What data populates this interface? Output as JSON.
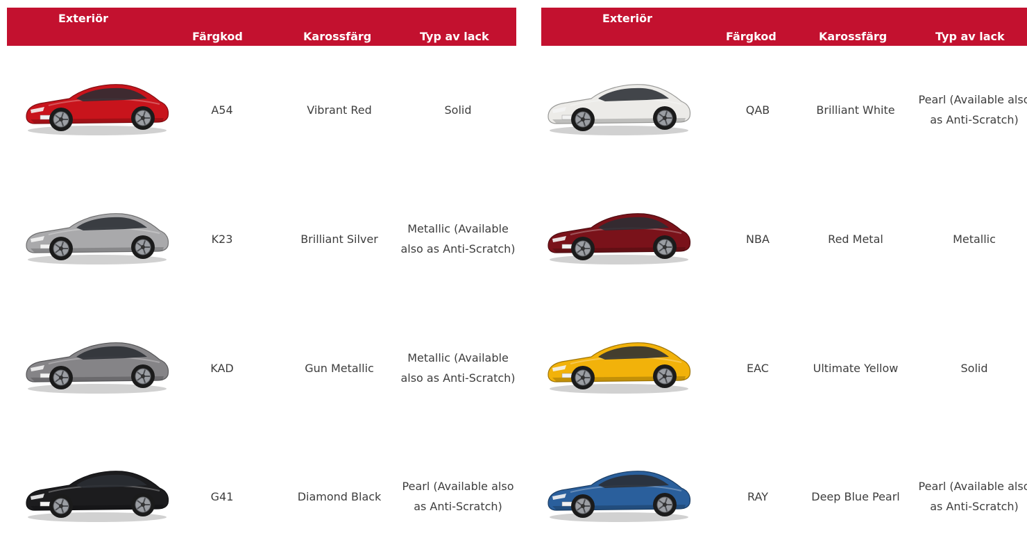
{
  "headers": {
    "exterior": "Exteriör",
    "color_code": "Färgkod",
    "body_color": "Karossfärg",
    "paint_type": "Typ av lack"
  },
  "colors": {
    "header_bg": "#c3112f",
    "header_text": "#ffffff",
    "text": "#3d3d3d"
  },
  "left_table": [
    {
      "code": "A54",
      "name": "Vibrant Red",
      "paint": "Solid",
      "car_color": "#c8141c",
      "car_icon": "car-red-icon"
    },
    {
      "code": "K23",
      "name": "Brilliant Silver",
      "paint": "Metallic (Available also as Anti-Scratch)",
      "car_color": "#a9a9ab",
      "car_icon": "car-silver-icon"
    },
    {
      "code": "KAD",
      "name": "Gun Metallic",
      "paint": "Metallic (Available also as Anti-Scratch)",
      "car_color": "#858487",
      "car_icon": "car-gunmetal-icon"
    },
    {
      "code": "G41",
      "name": "Diamond Black",
      "paint": "Pearl (Available also as Anti-Scratch)",
      "car_color": "#1c1c1e",
      "car_icon": "car-black-icon"
    }
  ],
  "right_table": [
    {
      "code": "QAB",
      "name": "Brilliant White",
      "paint": "Pearl (Available also as Anti-Scratch)",
      "car_color": "#ecebe8",
      "car_icon": "car-white-icon"
    },
    {
      "code": "NBA",
      "name": "Red Metal",
      "paint": "Metallic",
      "car_color": "#7a121a",
      "car_icon": "car-darkred-icon"
    },
    {
      "code": "EAC",
      "name": "Ultimate Yellow",
      "paint": "Solid",
      "car_color": "#f2b20a",
      "car_icon": "car-yellow-icon"
    },
    {
      "code": "RAY",
      "name": "Deep Blue Pearl",
      "paint": "Pearl (Available also as Anti-Scratch)",
      "car_color": "#2a5f9c",
      "car_icon": "car-blue-icon"
    }
  ]
}
